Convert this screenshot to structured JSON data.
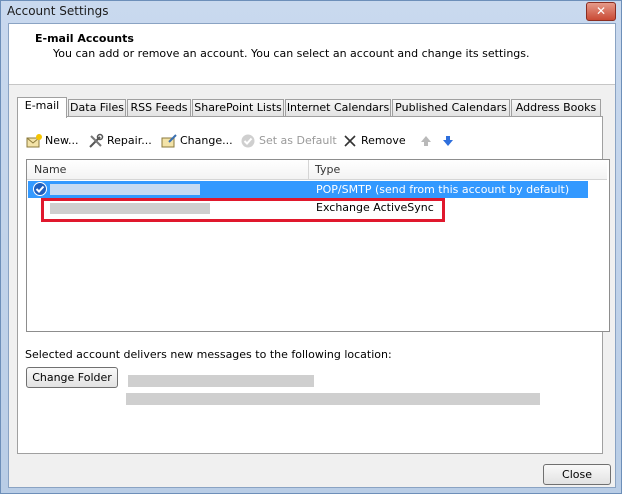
{
  "window": {
    "title": "Account Settings",
    "close_glyph": "✕"
  },
  "header": {
    "title": "E-mail Accounts",
    "description": "You can add or remove an account. You can select an account and change its settings."
  },
  "tabs": [
    {
      "label": "E-mail",
      "active": true
    },
    {
      "label": "Data Files",
      "active": false
    },
    {
      "label": "RSS Feeds",
      "active": false
    },
    {
      "label": "SharePoint Lists",
      "active": false
    },
    {
      "label": "Internet Calendars",
      "active": false
    },
    {
      "label": "Published Calendars",
      "active": false
    },
    {
      "label": "Address Books",
      "active": false
    }
  ],
  "toolbar": {
    "new_label": "New...",
    "repair_label": "Repair...",
    "change_label": "Change...",
    "set_default_label": "Set as Default",
    "remove_label": "Remove"
  },
  "list": {
    "col_name": "Name",
    "col_type": "Type",
    "rows": [
      {
        "type": "POP/SMTP (send from this account by default)",
        "selected": true
      },
      {
        "type": "Exchange ActiveSync",
        "selected": false
      }
    ]
  },
  "delivery": {
    "label": "Selected account delivers new messages to the following location:",
    "change_folder_label": "Change Folder"
  },
  "footer": {
    "close_label": "Close"
  },
  "colors": {
    "selection": "#3399ff",
    "highlight": "#e0182d"
  }
}
